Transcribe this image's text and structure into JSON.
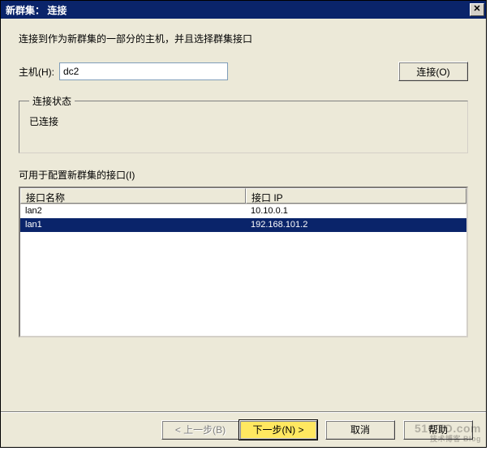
{
  "window": {
    "title": "新群集： 连接"
  },
  "intro": "连接到作为新群集的一部分的主机，并且选择群集接口",
  "host": {
    "label": "主机(H):",
    "value": "dc2",
    "connect_label": "连接(O)"
  },
  "status": {
    "legend": "连接状态",
    "text": "已连接"
  },
  "interfaces": {
    "caption": "可用于配置新群集的接口(I)",
    "columns": {
      "name": "接口名称",
      "ip": "接口 IP"
    },
    "rows": [
      {
        "name": "lan2",
        "ip": "10.10.0.1",
        "selected": false
      },
      {
        "name": "lan1",
        "ip": "192.168.101.2",
        "selected": true
      }
    ]
  },
  "buttons": {
    "back": "< 上一步(B)",
    "next": "下一步(N) >",
    "cancel": "取消",
    "help": "帮助"
  },
  "watermark": {
    "main": "51CTO.com",
    "sub": "技术博客 Blog"
  }
}
